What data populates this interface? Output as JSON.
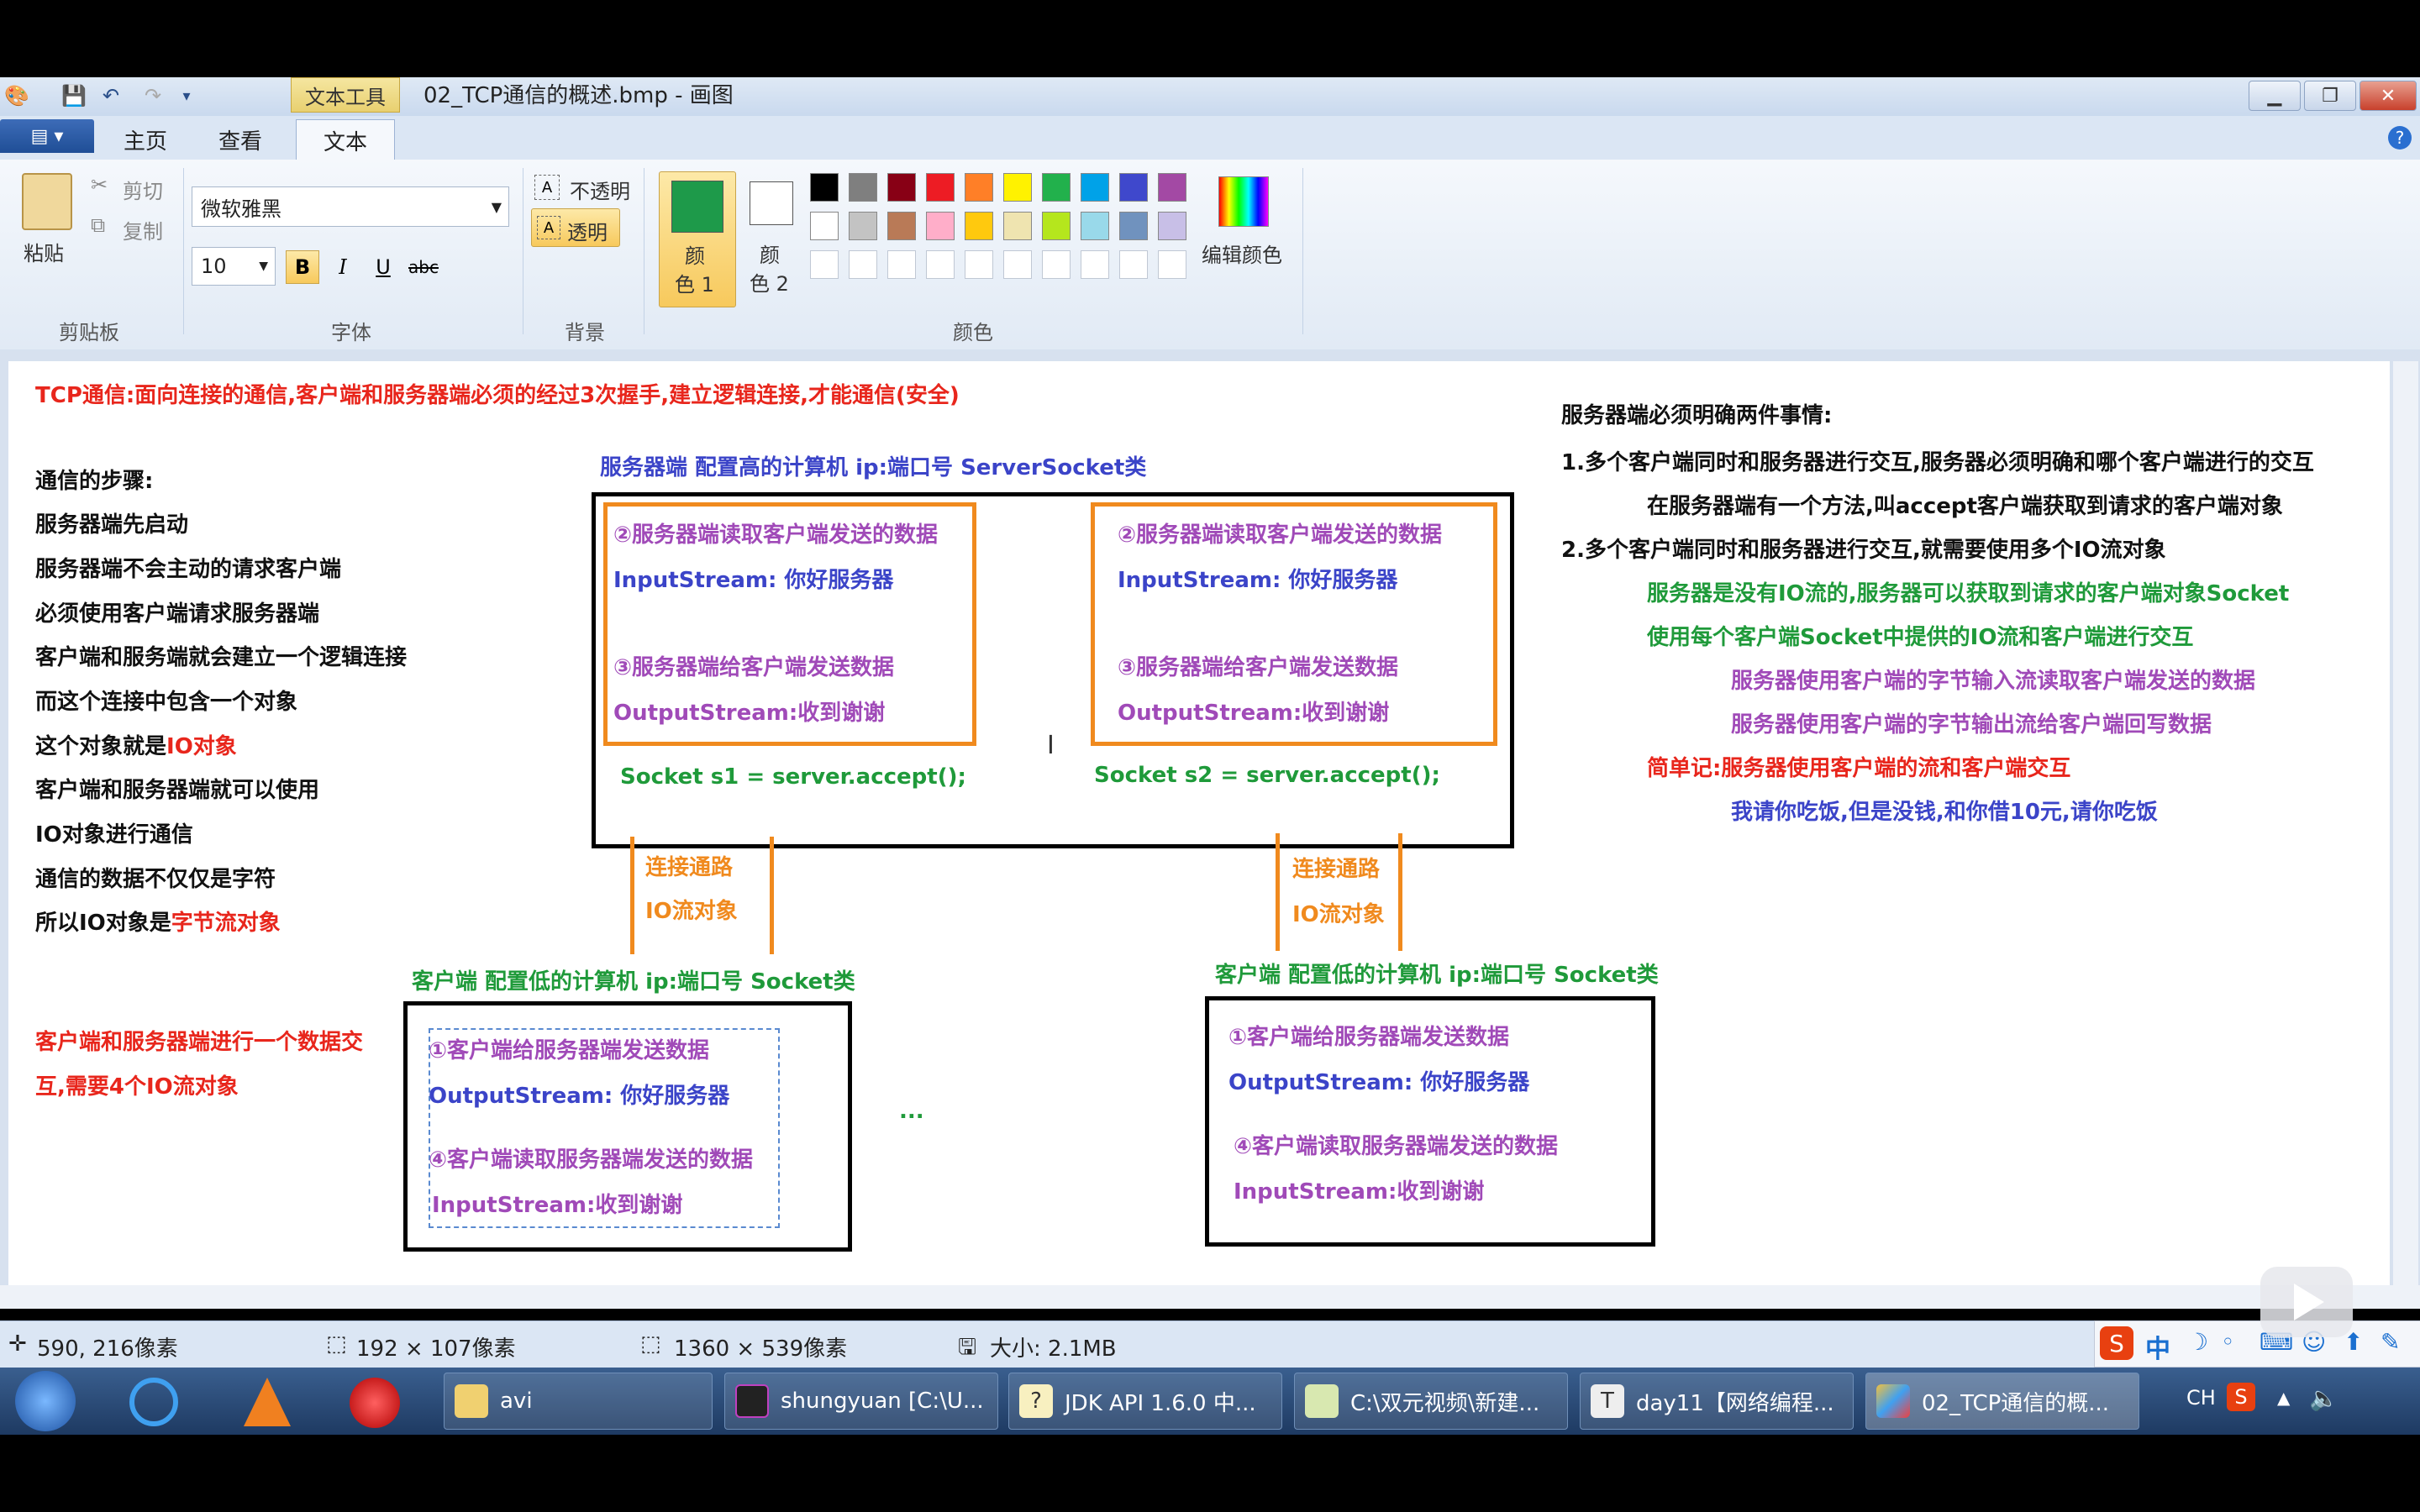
{
  "window": {
    "context_tab": "文本工具",
    "title": "02_TCP通信的概述.bmp - 画图"
  },
  "tabs": [
    "主页",
    "查看",
    "文本"
  ],
  "ribbon": {
    "clipboard": {
      "paste": "粘贴",
      "cut": "剪切",
      "copy": "复制",
      "label": "剪贴板"
    },
    "font": {
      "family": "微软雅黑",
      "size": "10",
      "bold": "B",
      "italic": "I",
      "underline": "U",
      "strike": "abc",
      "label": "字体"
    },
    "background": {
      "opaque": "不透明",
      "transparent": "透明",
      "label": "背景"
    },
    "colors": {
      "color1_a": "颜",
      "color1_b": "色 1",
      "color2_a": "颜",
      "color2_b": "色 2",
      "edit": "编辑颜色",
      "label": "颜色",
      "color1": "#1e9a4a",
      "color2": "#ffffff",
      "row1": [
        "#000000",
        "#7f7f7f",
        "#880015",
        "#ed1c24",
        "#ff7f27",
        "#fff200",
        "#22b14c",
        "#00a2e8",
        "#3f48cc",
        "#a349a4"
      ],
      "row2": [
        "#ffffff",
        "#c3c3c3",
        "#b97a57",
        "#ffaec9",
        "#ffc90e",
        "#efe4b0",
        "#b5e61d",
        "#99d9ea",
        "#7092be",
        "#c8bfe7"
      ]
    }
  },
  "canvas": {
    "header": "TCP通信:面向连接的通信,客户端和服务器端必须的经过3次握手,建立逻辑连接,才能通信(安全)",
    "steps_title": "通信的步骤:",
    "steps": [
      "服务器端先启动",
      "服务器端不会主动的请求客户端",
      "必须使用客户端请求服务器端",
      "客户端和服务端就会建立一个逻辑连接",
      "而这个连接中包含一个对象"
    ],
    "step_io_a": "这个对象就是",
    "step_io_b": "IO对象",
    "steps2": [
      "客户端和服务器端就可以使用",
      "IO对象进行通信",
      "通信的数据不仅仅是字符"
    ],
    "step_last_a": "所以IO对象是",
    "step_last_b": "字节流对象",
    "note_line1": "客户端和服务器端进行一个数据交",
    "note_line2": "互,需要4个IO流对象",
    "server_title": "服务器端 配置高的计算机 ip:端口号 ServerSocket类",
    "server_read": "②服务器端读取客户端发送的数据",
    "server_in": "InputStream: 你好服务器",
    "server_send": "③服务器端给客户端发送数据",
    "server_out": "OutputStream:收到谢谢",
    "socket1": "Socket s1 = server.accept();",
    "socket2": "Socket s2 = server.accept();",
    "link1": "连接通路",
    "link2": "IO流对象",
    "client_title": "客户端 配置低的计算机 ip:端口号  Socket类",
    "client_send": "①客户端给服务器端发送数据",
    "client_out": "OutputStream: 你好服务器",
    "client_read": "④客户端读取服务器端发送的数据",
    "client_in": "InputStream:收到谢谢",
    "ellipsis": "...",
    "right_title": "服务器端必须明确两件事情:",
    "right_1": "1.多个客户端同时和服务器进行交互,服务器必须明确和哪个客户端进行的交互",
    "right_1a": "在服务器端有一个方法,叫accept客户端获取到请求的客户端对象",
    "right_2": "2.多个客户端同时和服务器进行交互,就需要使用多个IO流对象",
    "right_2a": "服务器是没有IO流的,服务器可以获取到请求的客户端对象Socket",
    "right_2b": "使用每个客户端Socket中提供的IO流和客户端进行交互",
    "right_2c": "服务器使用客户端的字节输入流读取客户端发送的数据",
    "right_2d": "服务器使用客户端的字节输出流给客户端回写数据",
    "right_memo": "简单记:服务器使用客户端的流和客户端交互",
    "right_joke": "我请你吃饭,但是没钱,和你借10元,请你吃饭"
  },
  "status": {
    "cursor": "590, 216像素",
    "selection": "192 × 107像素",
    "image": "1360 × 539像素",
    "size": "大小: 2.1MB"
  },
  "taskbar": {
    "items": [
      "avi",
      "shungyuan [C:\\U...",
      "JDK API 1.6.0 中...",
      "C:\\双元视频\\新建...",
      "day11【网络编程...",
      "02_TCP通信的概..."
    ],
    "tray_lang": "CH",
    "tray_ime": "中"
  }
}
